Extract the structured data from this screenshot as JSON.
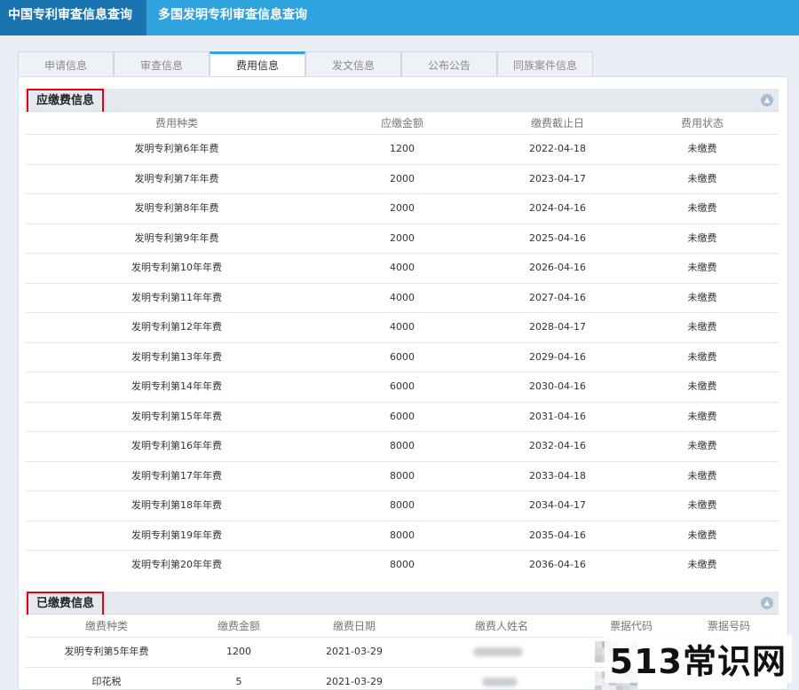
{
  "top_tabs": [
    "中国专利审查信息查询",
    "多国发明专利审查信息查询"
  ],
  "sub_tabs": [
    "申请信息",
    "审查信息",
    "费用信息",
    "发文信息",
    "公布公告",
    "同族案件信息"
  ],
  "due_section": {
    "title": "应缴费信息",
    "columns": [
      "费用种类",
      "应缴金额",
      "缴费截止日",
      "费用状态"
    ],
    "rows": [
      [
        "发明专利第6年年费",
        "1200",
        "2022-04-18",
        "未缴费"
      ],
      [
        "发明专利第7年年费",
        "2000",
        "2023-04-17",
        "未缴费"
      ],
      [
        "发明专利第8年年费",
        "2000",
        "2024-04-16",
        "未缴费"
      ],
      [
        "发明专利第9年年费",
        "2000",
        "2025-04-16",
        "未缴费"
      ],
      [
        "发明专利第10年年费",
        "4000",
        "2026-04-16",
        "未缴费"
      ],
      [
        "发明专利第11年年费",
        "4000",
        "2027-04-16",
        "未缴费"
      ],
      [
        "发明专利第12年年费",
        "4000",
        "2028-04-17",
        "未缴费"
      ],
      [
        "发明专利第13年年费",
        "6000",
        "2029-04-16",
        "未缴费"
      ],
      [
        "发明专利第14年年费",
        "6000",
        "2030-04-16",
        "未缴费"
      ],
      [
        "发明专利第15年年费",
        "6000",
        "2031-04-16",
        "未缴费"
      ],
      [
        "发明专利第16年年费",
        "8000",
        "2032-04-16",
        "未缴费"
      ],
      [
        "发明专利第17年年费",
        "8000",
        "2033-04-18",
        "未缴费"
      ],
      [
        "发明专利第18年年费",
        "8000",
        "2034-04-17",
        "未缴费"
      ],
      [
        "发明专利第19年年费",
        "8000",
        "2035-04-16",
        "未缴费"
      ],
      [
        "发明专利第20年年费",
        "8000",
        "2036-04-16",
        "未缴费"
      ]
    ]
  },
  "paid_section": {
    "title": "已缴费信息",
    "columns": [
      "缴费种类",
      "缴费金额",
      "缴费日期",
      "缴费人姓名",
      "票据代码",
      "票据号码"
    ],
    "rows": [
      [
        "发明专利第5年年费",
        "1200",
        "2021-03-29"
      ],
      [
        "印花税",
        "5",
        "2021-03-29"
      ]
    ]
  },
  "watermark": "513常识网"
}
